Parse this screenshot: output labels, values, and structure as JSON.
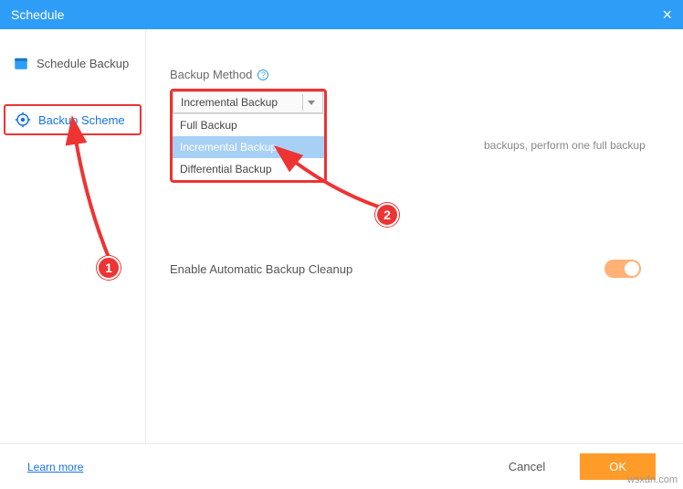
{
  "header": {
    "title": "Schedule",
    "close": "×"
  },
  "sidebar": {
    "items": [
      {
        "label": "Schedule Backup"
      },
      {
        "label": "Backup Scheme"
      }
    ]
  },
  "main": {
    "method_label": "Backup Method",
    "selected": "Incremental Backup",
    "options": [
      "Full Backup",
      "Incremental Backup",
      "Differential Backup"
    ],
    "hint": "backups, perform one full backup",
    "cleanup_label": "Enable Automatic Backup Cleanup"
  },
  "footer": {
    "learn": "Learn more",
    "cancel": "Cancel",
    "ok": "OK"
  },
  "callouts": {
    "one": "1",
    "two": "2"
  },
  "watermark": "wsxdn.com"
}
